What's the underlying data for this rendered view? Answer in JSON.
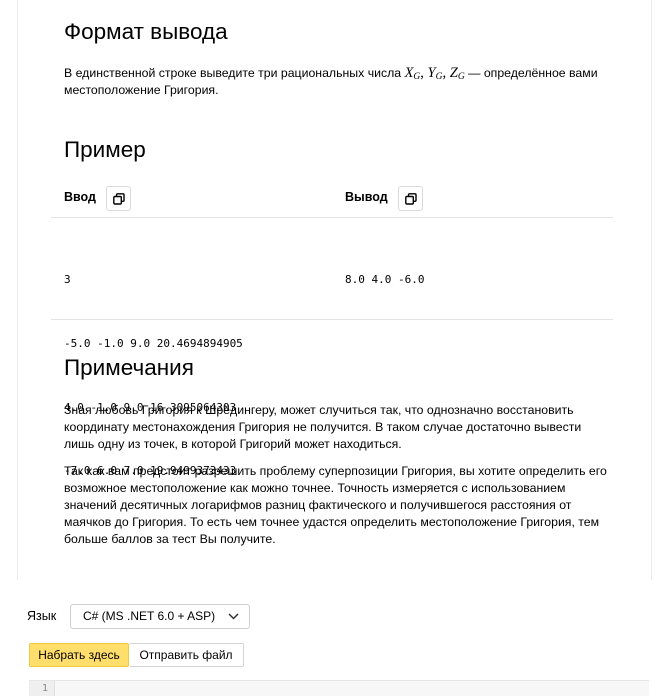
{
  "output_format": {
    "title": "Формат вывода",
    "text_before": "В единственной строке выведите три рациональных числа ",
    "math": [
      {
        "var": "X",
        "sub": "G",
        "sep": ", "
      },
      {
        "var": "Y",
        "sub": "G",
        "sep": ", "
      },
      {
        "var": "Z",
        "sub": "G",
        "sep": ""
      }
    ],
    "text_after": " — определённое вами",
    "text_line2": "местоположение Григория."
  },
  "example": {
    "title": "Пример",
    "input_label": "Ввод",
    "output_label": "Вывод",
    "copy_icon": "copy-icon",
    "input_lines": [
      "3",
      "-5.0 -1.0 9.0 20.4694894905",
      "4.0 -1.0 9.0 16.3095064303",
      "-7.0 6.0 7.0 19.9499373433"
    ],
    "output_lines": [
      "8.0 4.0 -6.0"
    ]
  },
  "notes": {
    "title": "Примечания",
    "paragraph1": [
      "Зная любовь Григория к Шрёдингеру, может случиться так, что однозначно восстановить",
      "координату местонахождения Григория не получится. В таком случае достаточно вывести",
      "лишь одну из точек, в которой Григорий может находиться."
    ],
    "paragraph2": [
      "Так как вам предстоит разрешить проблему суперпозиции Григория, вы хотите определить его",
      "возможное местоположение как можно точнее. Точность измеряется с использованием",
      "значений десятичных логарифмов разниц фактического и получившегося расстояния от",
      "маячков до Григория. То есть чем точнее удастся определить местоположение Григория, тем",
      "больше баллов за тест Вы получите."
    ]
  },
  "submission": {
    "language_label": "Язык",
    "language_value": "C# (MS .NET 6.0 + ASP)",
    "tab_write": "Набрать здесь",
    "tab_upload": "Отправить файл",
    "active_tab_color": "#ffde6b",
    "editor_line_number": "1"
  }
}
